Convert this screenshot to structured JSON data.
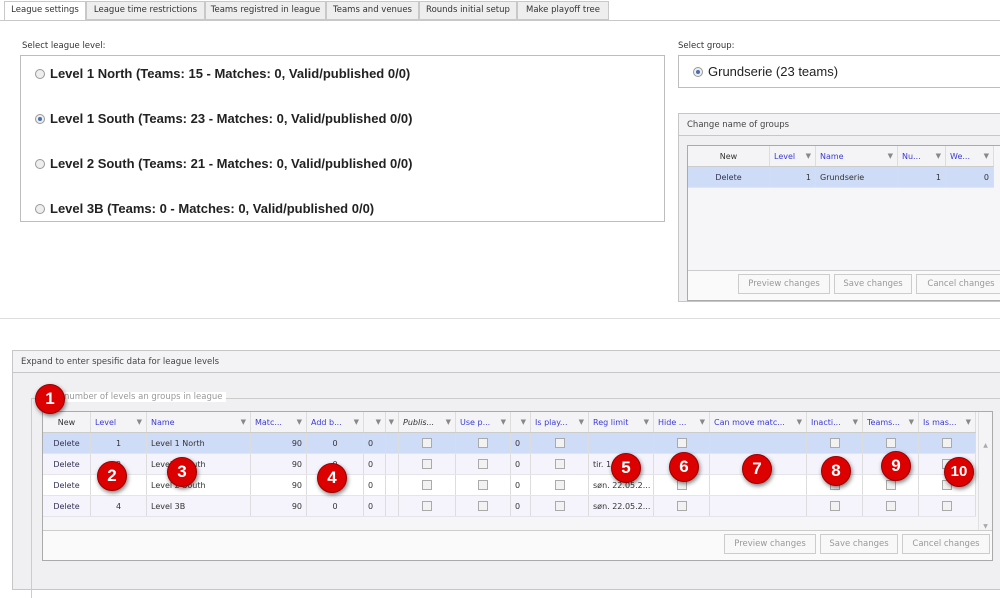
{
  "tabs": [
    "League settings",
    "League time restrictions",
    "Teams registred in league",
    "Teams and venues",
    "Rounds initial setup",
    "Make playoff tree"
  ],
  "level_select": {
    "label": "Select league level:",
    "options": [
      {
        "text": "Level 1 North (Teams: 15 - Matches: 0, Valid/published 0/0)",
        "selected": false
      },
      {
        "text": "Level 1 South (Teams: 23 - Matches: 0, Valid/published 0/0)",
        "selected": true
      },
      {
        "text": "Level 2 South (Teams: 21 - Matches: 0, Valid/published 0/0)",
        "selected": false
      },
      {
        "text": "Level 3B (Teams: 0 - Matches: 0, Valid/published 0/0)",
        "selected": false
      }
    ]
  },
  "group_select": {
    "label": "Select group:",
    "options": [
      {
        "text": "Grundserie (23 teams)",
        "selected": true
      }
    ]
  },
  "groups_panel": {
    "title": "Change name of groups",
    "headers": [
      "New",
      "Level",
      "Name",
      "Nu...",
      "We..."
    ],
    "rows": [
      [
        "Delete",
        "1",
        "Grundserie",
        "1",
        "0"
      ]
    ],
    "buttons": [
      "Preview changes",
      "Save changes",
      "Cancel changes"
    ]
  },
  "levels_panel": {
    "title": "Expand to enter spesific data for league levels",
    "legend": "number of levels an groups in league",
    "headers": [
      "New",
      "Level",
      "Name",
      "Matc...",
      "Add b...",
      "",
      "",
      "Publis...",
      "Use p...",
      "",
      "Is play...",
      "Reg limit",
      "Hide ...",
      "Can move matc...",
      "Inacti...",
      "Teams...",
      "Is mas..."
    ],
    "rows": [
      [
        "Delete",
        "1",
        "Level 1 North",
        "90",
        "0",
        "0",
        "",
        "chk",
        "chk",
        "0",
        "chk",
        "",
        "chk",
        "",
        "chk",
        "chk",
        "chk"
      ],
      [
        "Delete",
        "2",
        "Level 1 South",
        "90",
        "0",
        "0",
        "",
        "chk",
        "chk",
        "0",
        "chk",
        "tir. 1...",
        "chk",
        "",
        "chk",
        "chk",
        "chk"
      ],
      [
        "Delete",
        "3",
        "Level 2 South",
        "90",
        "0",
        "0",
        "",
        "chk",
        "chk",
        "0",
        "chk",
        "søn. 22.05.2...",
        "chk",
        "",
        "chk",
        "chk",
        "chk"
      ],
      [
        "Delete",
        "4",
        "Level 3B",
        "90",
        "0",
        "0",
        "",
        "chk",
        "chk",
        "0",
        "chk",
        "søn. 22.05.2...",
        "chk",
        "",
        "chk",
        "chk",
        "chk"
      ]
    ],
    "buttons": [
      "Preview changes",
      "Save changes",
      "Cancel changes"
    ]
  },
  "badges": [
    "1",
    "2",
    "3",
    "4",
    "5",
    "6",
    "7",
    "8",
    "9",
    "10"
  ],
  "colors": {
    "badge": "#dd0000",
    "header_link": "#3a3ad8",
    "selected_row": "#cfdcf7"
  }
}
